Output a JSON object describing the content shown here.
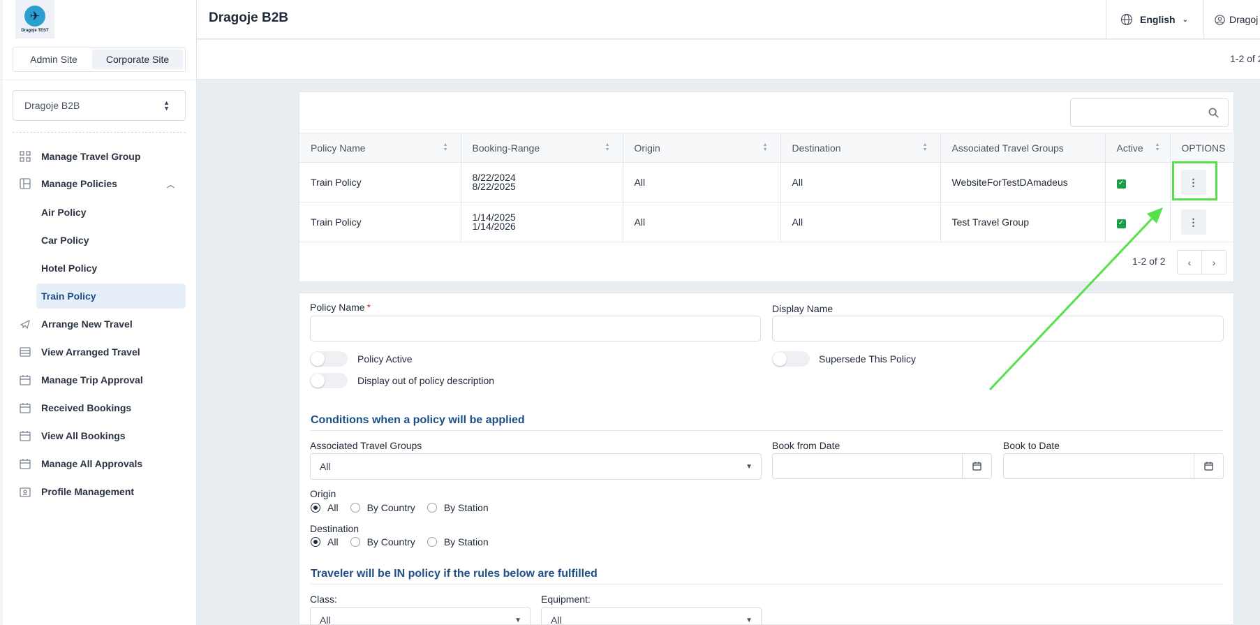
{
  "brand": {
    "logo_text": "Dragoje TEST"
  },
  "sidebar": {
    "site_switch": {
      "admin_label": "Admin Site",
      "corporate_label": "Corporate Site"
    },
    "company_select": "Dragoje B2B",
    "nav": {
      "manage_travel_group": "Manage Travel Group",
      "manage_policies": "Manage Policies",
      "policies_sub": [
        "Air Policy",
        "Car Policy",
        "Hotel Policy",
        "Train Policy"
      ],
      "arrange_new_travel": "Arrange New Travel",
      "view_arranged_travel": "View Arranged Travel",
      "manage_trip_approval": "Manage Trip Approval",
      "received_bookings": "Received Bookings",
      "view_all_bookings": "View All Bookings",
      "manage_all_approvals": "Manage All Approvals",
      "profile_management": "Profile Management"
    },
    "active_item": "Train Policy"
  },
  "header": {
    "title": "Dragoje B2B",
    "language": "English",
    "user": "Dragoj",
    "range_text": "1-2 of 2"
  },
  "table": {
    "search_placeholder": "",
    "columns": [
      "Policy Name",
      "Booking-Range",
      "Origin",
      "Destination",
      "Associated Travel Groups",
      "Active",
      "OPTIONS"
    ],
    "rows": [
      {
        "policy_name": "Train Policy",
        "range_start": "8/22/2024",
        "range_end": "8/22/2025",
        "origin": "All",
        "destination": "All",
        "groups": "WebsiteForTestDAmadeus",
        "active": true
      },
      {
        "policy_name": "Train Policy",
        "range_start": "1/14/2025",
        "range_end": "1/14/2026",
        "origin": "All",
        "destination": "All",
        "groups": "Test Travel Group",
        "active": true
      }
    ],
    "pager_text": "1-2 of 2"
  },
  "form": {
    "policy_name_label": "Policy Name",
    "required_mark": "*",
    "display_name_label": "Display Name",
    "policy_active_label": "Policy Active",
    "supersede_label": "Supersede This Policy",
    "display_out_label": "Display out of policy description",
    "conditions_title": "Conditions when a policy will be applied",
    "assoc_groups_label": "Associated Travel Groups",
    "assoc_groups_value": "All",
    "book_from_label": "Book from Date",
    "book_to_label": "Book to Date",
    "origin_label": "Origin",
    "destination_label": "Destination",
    "radio_options": [
      "All",
      "By Country",
      "By Station"
    ],
    "origin_selected": "All",
    "destination_selected": "All",
    "in_policy_title": "Traveler will be IN policy if the rules below are fulfilled",
    "class_label": "Class:",
    "class_value": "All",
    "equipment_label": "Equipment:",
    "equipment_value": "All"
  },
  "colors": {
    "accent_blue": "#1d4f87",
    "active_green": "#1a9e4a",
    "annotation_green": "#56e04a"
  }
}
